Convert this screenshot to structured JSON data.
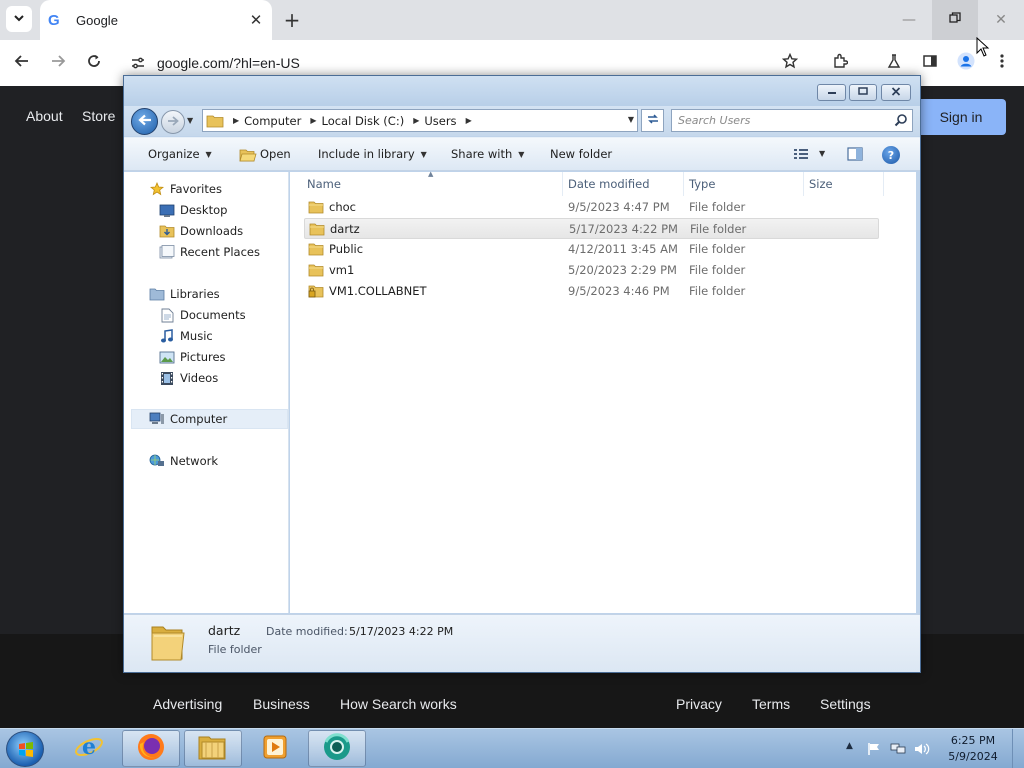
{
  "browser": {
    "tab_title": "Google",
    "tab_logo": "G",
    "url": "google.com/?hl=en-US",
    "icons": [
      "tab-dropdown-icon",
      "close-icon",
      "plus-icon",
      "minimize-icon",
      "restore-icon",
      "close-window-icon",
      "back-arrow-icon",
      "forward-arrow-icon",
      "reload-icon",
      "site-settings-icon",
      "star-icon",
      "extensions-icon",
      "labs-flask-icon",
      "side-panel-icon",
      "profile-icon",
      "more-vert-icon"
    ]
  },
  "google": {
    "top_links": [
      "About",
      "Store"
    ],
    "sign_in": "Sign in",
    "footer_left": [
      "Advertising",
      "Business",
      "How Search works"
    ],
    "footer_right": [
      "Privacy",
      "Terms",
      "Settings"
    ]
  },
  "explorer": {
    "breadcrumbs": [
      "Computer",
      "Local Disk (C:)",
      "Users"
    ],
    "search_placeholder": "Search Users",
    "commands": {
      "organize": "Organize",
      "open": "Open",
      "include_in_library": "Include in library",
      "share_with": "Share with",
      "new_folder": "New folder"
    },
    "nav": {
      "favorites": "Favorites",
      "favorites_items": [
        "Desktop",
        "Downloads",
        "Recent Places"
      ],
      "libraries": "Libraries",
      "libraries_items": [
        "Documents",
        "Music",
        "Pictures",
        "Videos"
      ],
      "computer": "Computer",
      "network": "Network"
    },
    "columns": [
      "Name",
      "Date modified",
      "Type",
      "Size"
    ],
    "files": [
      {
        "name": "choc",
        "date": "9/5/2023 4:47 PM",
        "type": "File folder",
        "selected": false
      },
      {
        "name": "dartz",
        "date": "5/17/2023 4:22 PM",
        "type": "File folder",
        "selected": true
      },
      {
        "name": "Public",
        "date": "4/12/2011 3:45 AM",
        "type": "File folder",
        "selected": false
      },
      {
        "name": "vm1",
        "date": "5/20/2023 2:29 PM",
        "type": "File folder",
        "selected": false
      },
      {
        "name": "VM1.COLLABNET",
        "date": "9/5/2023 4:46 PM",
        "type": "File folder",
        "selected": false
      }
    ],
    "details": {
      "name": "dartz",
      "type": "File folder",
      "date_label": "Date modified:",
      "date_value": "5/17/2023 4:22 PM"
    }
  },
  "taskbar": {
    "time": "6:25 PM",
    "date": "5/9/2024",
    "pinned": [
      "internet-explorer-icon",
      "firefox-icon",
      "file-explorer-icon",
      "media-player-icon",
      "chrome-like-app-icon"
    ]
  },
  "colors": {
    "google_bg": "#202124",
    "sign_in_bg": "#8ab4f8",
    "explorer_frame": "#bfd3ea",
    "taskbar": "#94b4d9"
  }
}
